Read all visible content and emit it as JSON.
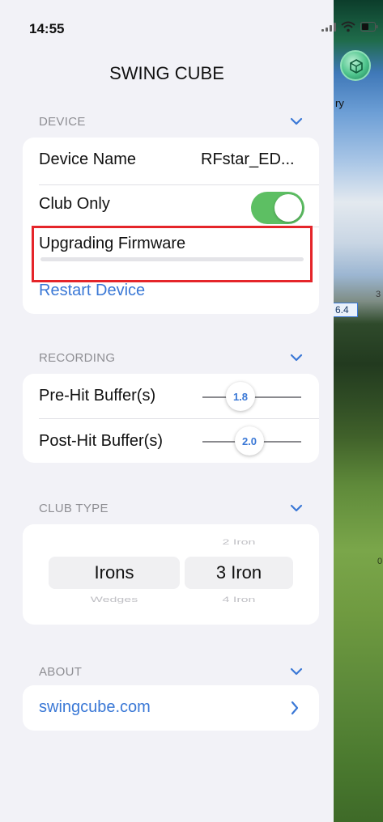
{
  "status_bar": {
    "time": "14:55"
  },
  "header": {
    "title": "SWING CUBE"
  },
  "background": {
    "label_ry": "ry",
    "tag": "6.4",
    "tick_3": "3",
    "tick_0": "0"
  },
  "device": {
    "header": "DEVICE",
    "device_name_label": "Device Name",
    "device_name_value": "RFstar_ED...",
    "club_only_label": "Club Only",
    "club_only_on": true,
    "firmware_label": "Upgrading Firmware",
    "firmware_progress": 0.0,
    "restart_label": "Restart Device"
  },
  "recording": {
    "header": "RECORDING",
    "pre_hit_label": "Pre-Hit Buffer(s)",
    "pre_hit_value": "1.8",
    "post_hit_label": "Post-Hit Buffer(s)",
    "post_hit_value": "2.0"
  },
  "club_type": {
    "header": "CLUB TYPE",
    "category_selected": "Irons",
    "category_next": "Wedges",
    "club_prev": "2 Iron",
    "club_selected": "3 Iron",
    "club_next": "4 Iron"
  },
  "about": {
    "header": "ABOUT",
    "link_label": "swingcube.com"
  },
  "colors": {
    "accent": "#3a78d6",
    "toggle_on": "#5dbf63",
    "highlight": "#e5252a"
  }
}
